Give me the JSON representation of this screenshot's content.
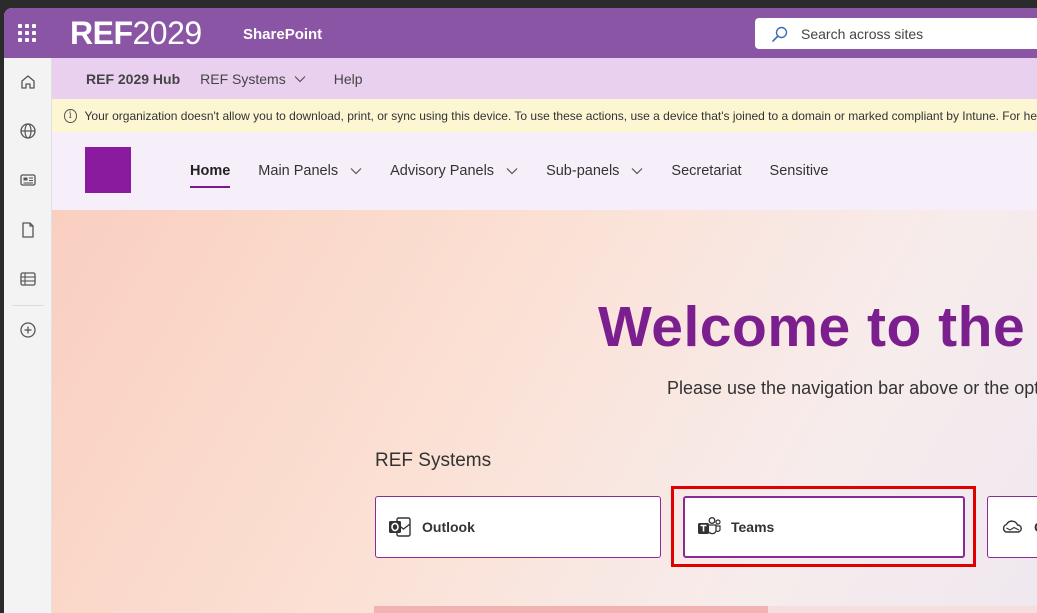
{
  "suite_bar": {
    "logo_bold": "REF",
    "logo_thin": "2029",
    "app_name": "SharePoint",
    "search_placeholder": "Search across sites"
  },
  "app_bar": {
    "icons": [
      "home-icon",
      "globe-icon",
      "news-icon",
      "document-icon",
      "list-icon",
      "add-icon"
    ]
  },
  "hub_nav": {
    "title": "REF 2029 Hub",
    "items": [
      {
        "label": "REF Systems",
        "has_dropdown": true
      },
      {
        "label": "Help",
        "has_dropdown": false
      }
    ]
  },
  "info_bar": {
    "message": "Your organization doesn't allow you to download, print, or sync using this device. To use these actions, use a device that's joined to a domain or marked compliant by Intune. For he"
  },
  "site_nav": {
    "items": [
      {
        "label": "Home",
        "active": true,
        "has_dropdown": false
      },
      {
        "label": "Main Panels",
        "active": false,
        "has_dropdown": true
      },
      {
        "label": "Advisory Panels",
        "active": false,
        "has_dropdown": true
      },
      {
        "label": "Sub-panels",
        "active": false,
        "has_dropdown": true
      },
      {
        "label": "Secretariat",
        "active": false,
        "has_dropdown": false
      },
      {
        "label": "Sensitive",
        "active": false,
        "has_dropdown": false
      }
    ]
  },
  "hero": {
    "welcome": "Welcome to the R",
    "subtitle": "Please use the navigation bar above or the opt",
    "systems_title": "REF Systems",
    "cards": [
      {
        "label": "Outlook",
        "icon": "outlook-icon"
      },
      {
        "label": "Teams",
        "icon": "teams-icon",
        "highlighted": true
      },
      {
        "label": "O",
        "icon": "onedrive-icon"
      }
    ]
  },
  "colors": {
    "suite_bar": "#8b55a6",
    "hub_nav": "#ead0ef",
    "info_bar": "#fdf6d3",
    "accent": "#7b1f8f",
    "highlight": "#e10000"
  }
}
